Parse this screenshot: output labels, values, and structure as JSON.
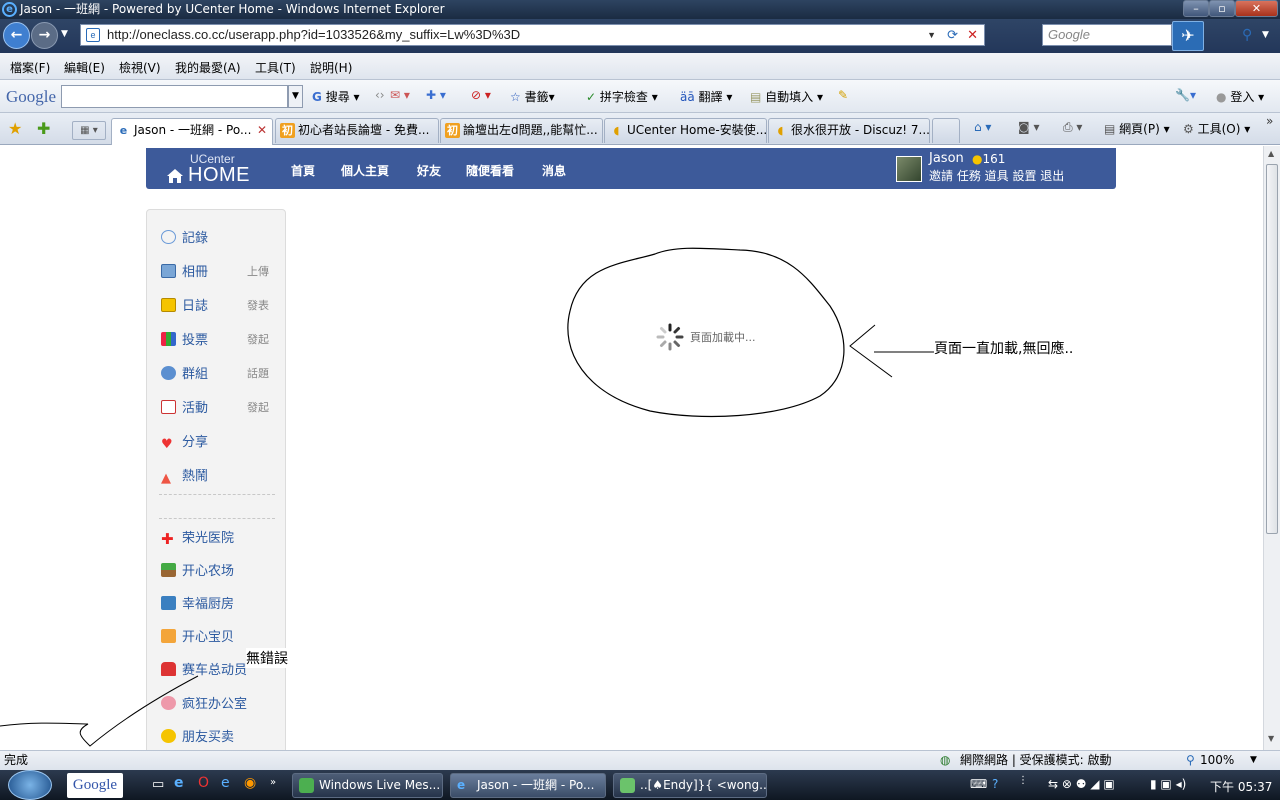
{
  "window": {
    "title": "Jason - 一班網 - Powered by UCenter Home - Windows Internet Explorer"
  },
  "address_bar": {
    "url": "http://oneclass.co.cc/userapp.php?id=1033526&my_suffix=Lw%3D%3D",
    "search_placeholder": "Google"
  },
  "menu": [
    "檔案(F)",
    "編輯(E)",
    "檢視(V)",
    "我的最愛(A)",
    "工具(T)",
    "說明(H)"
  ],
  "google_toolbar": {
    "logo": "Google",
    "items": [
      "搜尋",
      "書籤",
      "拼字檢查",
      "翻譯",
      "自動填入",
      "登入"
    ]
  },
  "tabs": [
    {
      "label": "Jason - 一班網 - Po...",
      "active": true
    },
    {
      "label": "初心者站長論壇 - 免費...",
      "active": false
    },
    {
      "label": "論壇出左d問題,,能幫忙...",
      "active": false
    },
    {
      "label": "UCenter Home-安裝使...",
      "active": false
    },
    {
      "label": "很水很开放 - Discuz! 7....",
      "active": false
    }
  ],
  "command_bar": {
    "page_label": "網頁(P)",
    "tools_label": "工具(O)"
  },
  "site_header": {
    "brand_small": "UCenter",
    "brand_big": "HOME",
    "nav": [
      "首頁",
      "個人主頁",
      "好友",
      "隨便看看",
      "消息"
    ],
    "user_name": "Jason",
    "credits": "161",
    "user_links": "邀請 任務 道具 設置 退出"
  },
  "sidebar": {
    "items": [
      {
        "label": "記錄",
        "action": "",
        "icon": "chat-bubble-icon"
      },
      {
        "label": "相冊",
        "action": "上傳",
        "icon": "photo-album-icon"
      },
      {
        "label": "日誌",
        "action": "發表",
        "icon": "lock-journal-icon"
      },
      {
        "label": "投票",
        "action": "發起",
        "icon": "bar-chart-icon"
      },
      {
        "label": "群組",
        "action": "話題",
        "icon": "group-icon"
      },
      {
        "label": "活動",
        "action": "發起",
        "icon": "calendar-icon"
      },
      {
        "label": "分享",
        "action": "",
        "icon": "heart-share-icon"
      },
      {
        "label": "熱鬧",
        "action": "",
        "icon": "fire-icon"
      }
    ],
    "apps": [
      {
        "label": "荣光医院",
        "icon": "red-cross-icon"
      },
      {
        "label": "开心农场",
        "icon": "plant-icon"
      },
      {
        "label": "幸福厨房",
        "icon": "kitchen-icon"
      },
      {
        "label": "开心宝贝",
        "icon": "baby-icon"
      },
      {
        "label": "赛车总动员",
        "icon": "racecar-icon"
      },
      {
        "label": "疯狂办公室",
        "icon": "office-icon"
      },
      {
        "label": "朋友买卖",
        "icon": "coins-icon"
      }
    ]
  },
  "loading": {
    "text": "頁面加載中..."
  },
  "annotations": {
    "loading_note": "頁面一直加載,無回應..",
    "no_error_note": "無錯誤"
  },
  "status_bar": {
    "left": "完成",
    "zone": "網際網路 | 受保護模式: 啟動",
    "zoom": "100%"
  },
  "taskbar": {
    "buttons": [
      "Windows Live Mes...",
      "Jason - 一班網 - Po...",
      "..[♠Endy]}{ <wong..."
    ],
    "google_label": "Google",
    "clock": "下午 05:37"
  },
  "colors": {
    "header_blue": "#3d5a9a",
    "link_blue": "#2c5aa0",
    "chrome_dark": "#23375a"
  }
}
